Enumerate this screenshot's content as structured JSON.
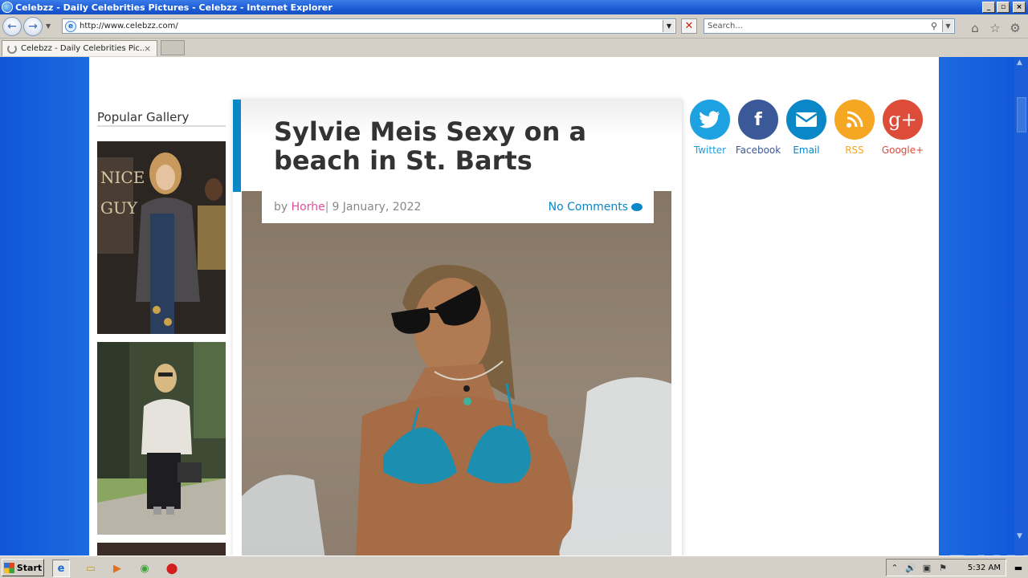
{
  "window": {
    "title": "Celebzz - Daily Celebrities Pictures - Celebzz - Internet Explorer",
    "min_label": "_",
    "max_label": "▫",
    "close_label": "×"
  },
  "toolbar": {
    "back_icon": "back-arrow-icon",
    "forward_icon": "forward-arrow-icon",
    "url": "http://www.celebzz.com/",
    "search_placeholder": "Search...",
    "stop_label": "✕",
    "home_icon": "⌂",
    "favorites_icon": "☆",
    "tools_icon": "⚙"
  },
  "tabs": [
    {
      "label": "Celebzz - Daily Celebrities Pic...",
      "close": "×"
    }
  ],
  "page": {
    "sidebar": {
      "title": "Popular Gallery"
    },
    "article": {
      "title": "Sylvie Meis Sexy on a beach in St. Barts",
      "by": "by",
      "author": "Horhe",
      "sep": "|",
      "date": "9 January, 2022",
      "comments": "No Comments"
    },
    "social": [
      {
        "name": "Twitter",
        "glyph": "🐦",
        "color": "#1da1e0"
      },
      {
        "name": "Facebook",
        "glyph": "f",
        "color": "#3b5998"
      },
      {
        "name": "Email",
        "glyph": "✉",
        "color": "#0a87c6"
      },
      {
        "name": "RSS",
        "glyph": "◔",
        "color": "#f5a623"
      },
      {
        "name": "Google+",
        "glyph": "g+",
        "color": "#dd4b39"
      }
    ]
  },
  "watermark": "ANY▷RUN",
  "taskbar": {
    "start_label": "Start",
    "clock": "5:32 AM"
  }
}
